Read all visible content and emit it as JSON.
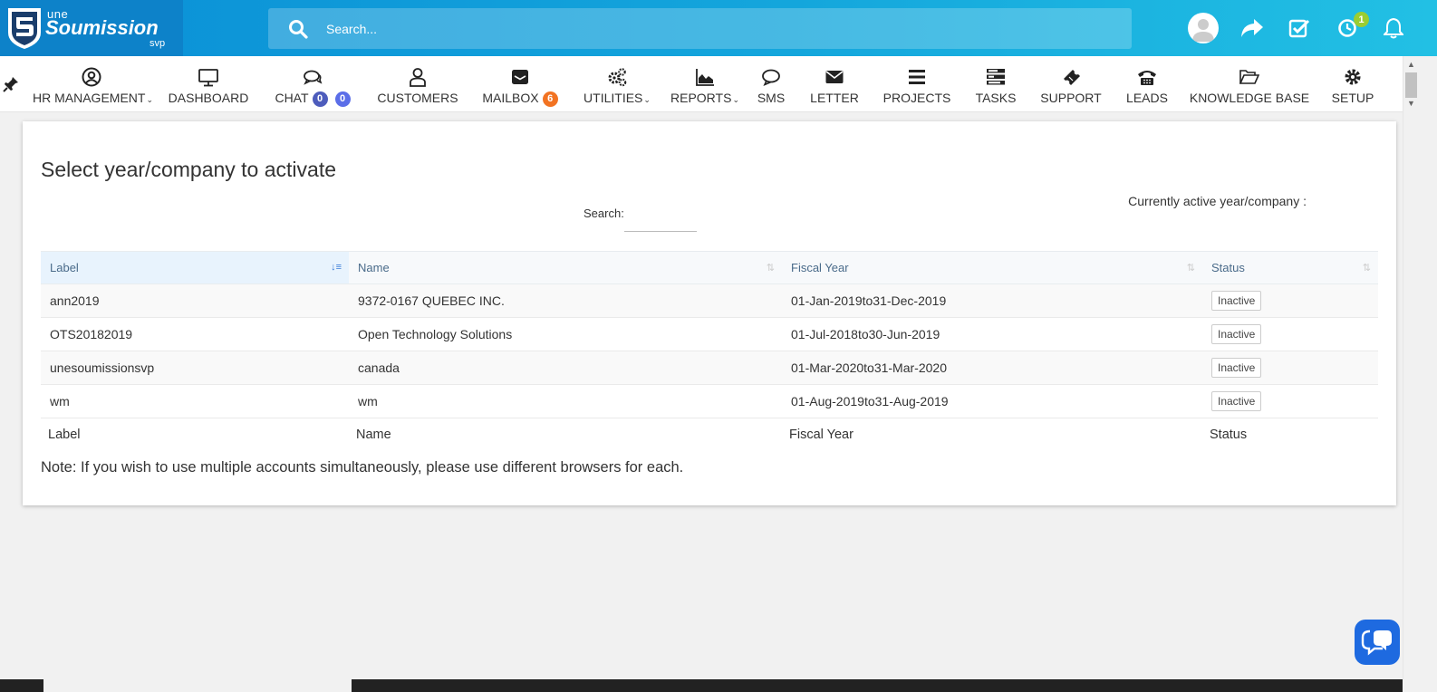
{
  "header": {
    "logo": {
      "line1": "une",
      "line2": "Soumission",
      "line3": "svp"
    },
    "search_placeholder": "Search...",
    "notification_count": "1",
    "icons": [
      "user-avatar",
      "share-icon",
      "checkbox-icon",
      "clock-icon",
      "bell-icon"
    ]
  },
  "nav": {
    "items": [
      {
        "label": "HR MANAGEMENT",
        "icon": "user-circle-icon",
        "dropdown": true
      },
      {
        "label": "DASHBOARD",
        "icon": "monitor-icon"
      },
      {
        "label": "CHAT",
        "icon": "chat-bubbles-icon",
        "badges": [
          "0",
          "0"
        ]
      },
      {
        "label": "CUSTOMERS",
        "icon": "user-outline-icon"
      },
      {
        "label": "MAILBOX",
        "icon": "inbox-icon",
        "badge": "6"
      },
      {
        "label": "UTILITIES",
        "icon": "cogs-icon",
        "dropdown": true
      },
      {
        "label": "REPORTS",
        "icon": "area-chart-icon",
        "dropdown": true
      },
      {
        "label": "SMS",
        "icon": "comments-icon"
      },
      {
        "label": "LETTER",
        "icon": "envelope-icon"
      },
      {
        "label": "PROJECTS",
        "icon": "bars-icon"
      },
      {
        "label": "TASKS",
        "icon": "tasks-icon"
      },
      {
        "label": "SUPPORT",
        "icon": "ticket-icon"
      },
      {
        "label": "LEADS",
        "icon": "phone-icon"
      },
      {
        "label": "KNOWLEDGE BASE",
        "icon": "folder-open-icon"
      },
      {
        "label": "SETUP",
        "icon": "gear-icon"
      }
    ],
    "colors": {
      "chat_badge": "#4d5cbc",
      "chat_badge2": "#5b6ee8",
      "mailbox_badge": "#f27322"
    }
  },
  "panel": {
    "title": "Select year/company to activate",
    "active_label": "Currently active year/company :",
    "search_label": "Search:",
    "table": {
      "columns": [
        "Label",
        "Name",
        "Fiscal Year",
        "Status"
      ],
      "rows": [
        {
          "label": "ann2019",
          "name": "9372-0167 QUEBEC INC.",
          "fiscal_year": "01-Jan-2019to31-Dec-2019",
          "status": "Inactive"
        },
        {
          "label": "OTS20182019",
          "name": "Open Technology Solutions",
          "fiscal_year": "01-Jul-2018to30-Jun-2019",
          "status": "Inactive"
        },
        {
          "label": "unesoumissionsvp",
          "name": "canada",
          "fiscal_year": "01-Mar-2020to31-Mar-2020",
          "status": "Inactive"
        },
        {
          "label": "wm",
          "name": "wm",
          "fiscal_year": "01-Aug-2019to31-Aug-2019",
          "status": "Inactive"
        }
      ],
      "footer": [
        "Label",
        "Name",
        "Fiscal Year",
        "Status"
      ]
    },
    "note": "Note: If you wish to use multiple accounts simultaneously, please use different browsers for each."
  }
}
